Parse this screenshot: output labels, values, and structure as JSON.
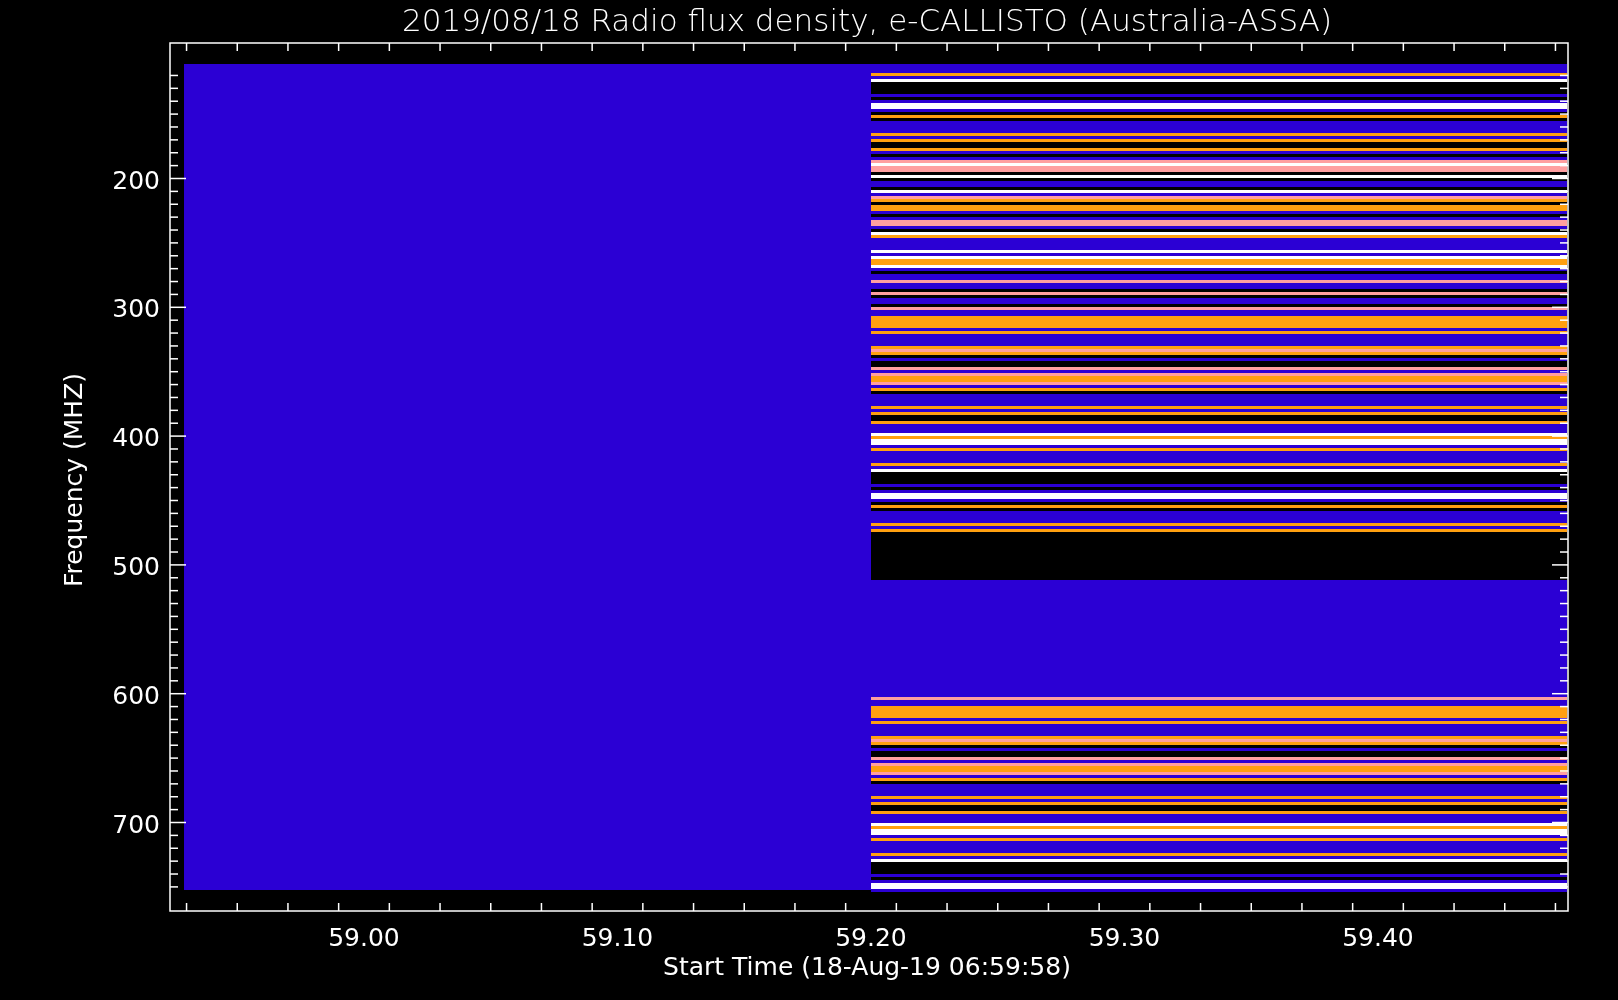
{
  "title": "2019/08/18  Radio flux density, e-CALLISTO (Australia-ASSA)",
  "x_axis": {
    "label": "Start Time (18-Aug-19 06:59:58)",
    "tick_labels": [
      "59.00",
      "59.10",
      "59.20",
      "59.30",
      "59.40"
    ]
  },
  "y_axis": {
    "label": "Frequency (MHZ)",
    "tick_labels": [
      "200",
      "300",
      "400",
      "500",
      "600",
      "700"
    ]
  }
}
